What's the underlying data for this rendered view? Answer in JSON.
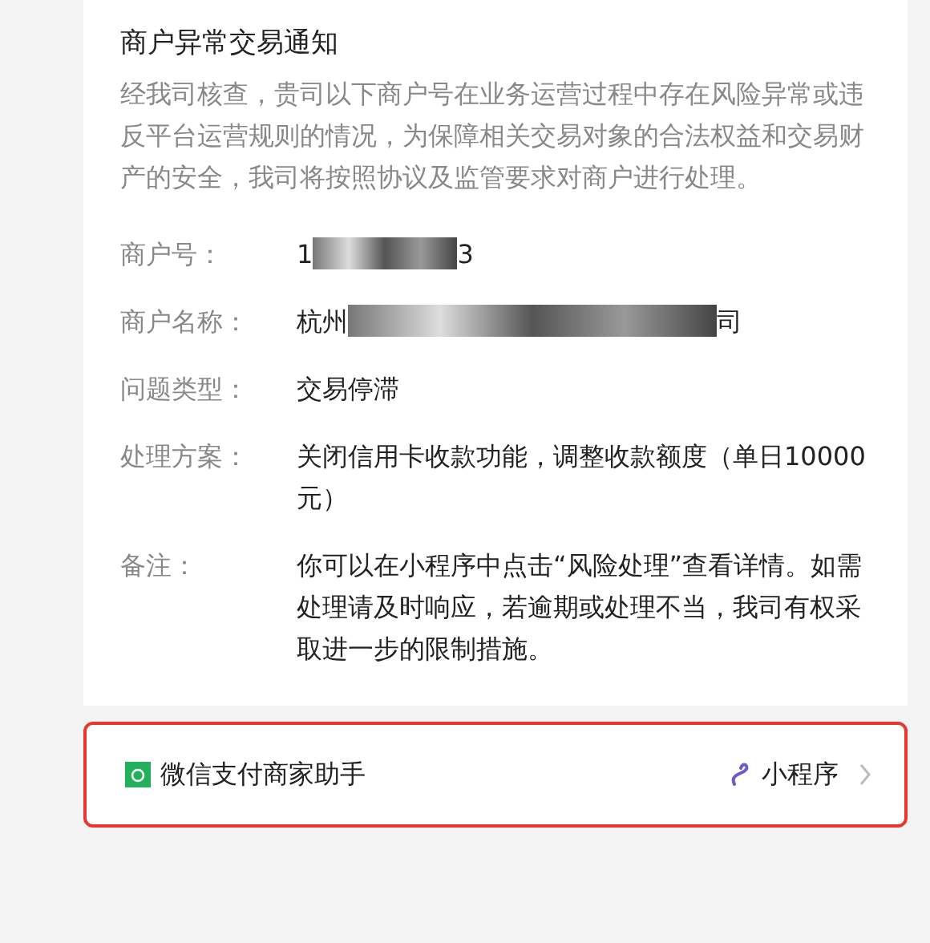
{
  "card": {
    "title": "商户异常交易通知",
    "intro": "经我司核查，贵司以下商户号在业务运营过程中存在风险异常或违反平台运营规则的情况，为保障相关交易对象的合法权益和交易财产的安全，我司将按照协议及监管要求对商户进行处理。",
    "fields": [
      {
        "label": "商户号：",
        "value_start": "1",
        "value_end": "3",
        "redacted": true
      },
      {
        "label": "商户名称：",
        "value_start": "杭州",
        "value_end": "司",
        "redacted": true
      },
      {
        "label": "问题类型：",
        "value_start": "交易停滞",
        "redacted": false
      },
      {
        "label": "处理方案：",
        "value_start": "关闭信用卡收款功能，调整收款额度（单日10000元）",
        "redacted": false
      },
      {
        "label": "备注：",
        "value_start": "你可以在小程序中点击“风险处理”查看详情。如需处理请及时响应，若逾期或处理不当，我司有权采取进一步的限制措施。",
        "redacted": false
      }
    ]
  },
  "footer": {
    "source": "微信支付商家助手",
    "type": "小程序",
    "highlighted": true
  }
}
